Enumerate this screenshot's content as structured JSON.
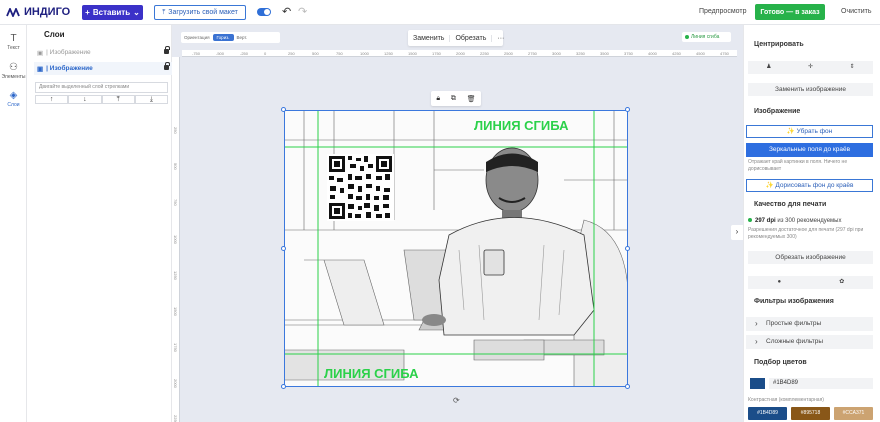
{
  "app": {
    "logo": "ИНДИГО",
    "insert_label": "Вставить",
    "upload_label": "Загрузить свой макет",
    "preview_label": "Предпросмотр",
    "done_label": "Готово — в заказ",
    "clear_label": "Очистить"
  },
  "sidebar": {
    "items": [
      {
        "label": "Текст",
        "icon": "text-icon"
      },
      {
        "label": "Элементы",
        "icon": "elements-icon"
      },
      {
        "label": "Слои",
        "icon": "layers-icon"
      }
    ]
  },
  "layers": {
    "title": "Слои",
    "rows": [
      "| Изображение",
      "| Изображение"
    ],
    "hint": "Двигайте выделенный слой стрелками",
    "arrows": [
      "↑",
      "↓",
      "⤒",
      "⤓"
    ]
  },
  "workspace": {
    "orient_label": "Ориентация",
    "orient_h": "Гориз.",
    "orient_v": "Верт.",
    "replace_label": "Заменить",
    "crop_label": "Обрезать",
    "more_label": "···",
    "fold_label": "Линия сгиба",
    "fold_text_top": "ЛИНИЯ СГИБА",
    "fold_text_bottom": "ЛИНИЯ СГИБА",
    "ruler_h": [
      "-750",
      "-500",
      "-250",
      "0",
      "250",
      "500",
      "750",
      "1000",
      "1250",
      "1500",
      "1750",
      "2000",
      "2250",
      "2500",
      "2750",
      "3000",
      "3250",
      "3500",
      "3750",
      "4000",
      "4250",
      "4500",
      "4750",
      "5000"
    ],
    "ruler_v": [
      "250",
      "500",
      "750",
      "1000",
      "1250",
      "1500",
      "1750",
      "2000",
      "2250"
    ]
  },
  "panel": {
    "center_title": "Центрировать",
    "replace_image": "Заменить изображение",
    "image_title": "Изображение",
    "remove_bg": "✨ Убрать фон",
    "mirror": "Зеркальные поля до краёв",
    "mirror_note": "Отражает край картинки в поля. Ничего не дорисовывает",
    "extend_bg": "✨ Дорисовать фон до краёв",
    "quality_title": "Качество для печати",
    "dpi_value": "297 dpi",
    "dpi_rest": " из 300 рекомендуемых",
    "dpi_note": "Разрешения достаточное для печати (297 dpi при рекомендуемых 300)",
    "crop_image": "Обрезать изображение",
    "filters_title": "Фильтры изображения",
    "filter_simple": "Простые фильтры",
    "filter_complex": "Сложные фильтры",
    "colors_title": "Подбор цветов",
    "color_value": "#1B4D89",
    "contrast_label": "Контрастная (комплементарная)",
    "chips": [
      {
        "label": "#1B4D89",
        "color": "#1b4d89"
      },
      {
        "label": "#895718",
        "color": "#895718"
      },
      {
        "label": "#CCA371",
        "color": "#cca371"
      }
    ]
  }
}
